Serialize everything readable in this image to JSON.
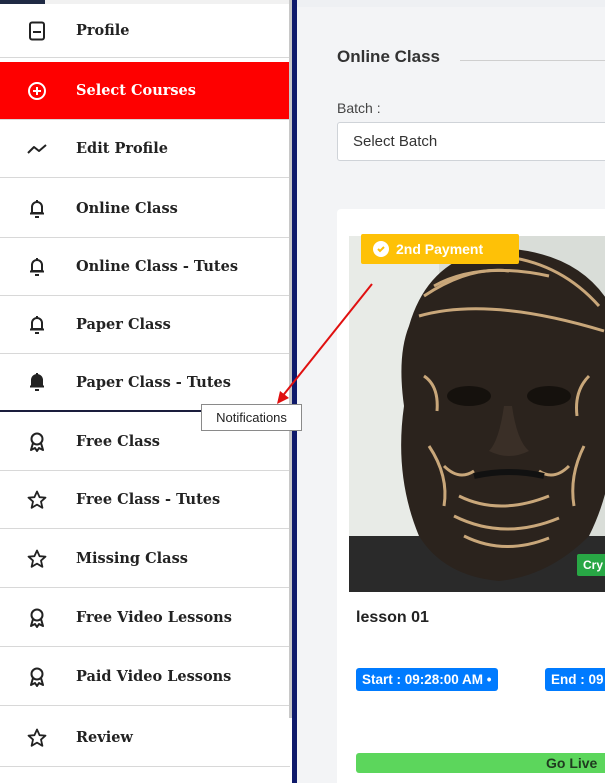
{
  "sidebar": {
    "items": [
      {
        "label": "Profile",
        "icon": "document-icon"
      },
      {
        "label": "Select Courses",
        "icon": "plus-circle-icon",
        "active": true
      },
      {
        "label": "Edit Profile",
        "icon": "trend-line-icon"
      },
      {
        "label": "Online Class",
        "icon": "bell-icon"
      },
      {
        "label": "Online Class - Tutes",
        "icon": "bell-icon"
      },
      {
        "label": "Paper Class",
        "icon": "bell-icon"
      },
      {
        "label": "Paper Class - Tutes",
        "icon": "bell-icon"
      },
      {
        "label": "Free Class",
        "icon": "award-icon"
      },
      {
        "label": "Free Class - Tutes",
        "icon": "star-icon"
      },
      {
        "label": "Missing Class",
        "icon": "star-icon"
      },
      {
        "label": "Free Video Lessons",
        "icon": "award-icon"
      },
      {
        "label": "Paid Video Lessons",
        "icon": "award-icon"
      },
      {
        "label": "Review",
        "icon": "star-icon"
      }
    ]
  },
  "tooltip": {
    "text": "Notifications"
  },
  "main": {
    "title": "Online Class",
    "batch_label": "Batch :",
    "batch_select": "Select Batch"
  },
  "card": {
    "badge": "2nd Payment",
    "image_tag": "Cry",
    "lesson_title": "lesson 01",
    "start": "Start : 09:28:00 AM •",
    "end": "End : 09",
    "go_live": "Go Live"
  },
  "colors": {
    "active_bg": "#fe0000",
    "badge": "#fec107",
    "time_badge": "#007bff",
    "go_live": "#5cd65c",
    "divider": "#0f1a6b"
  }
}
